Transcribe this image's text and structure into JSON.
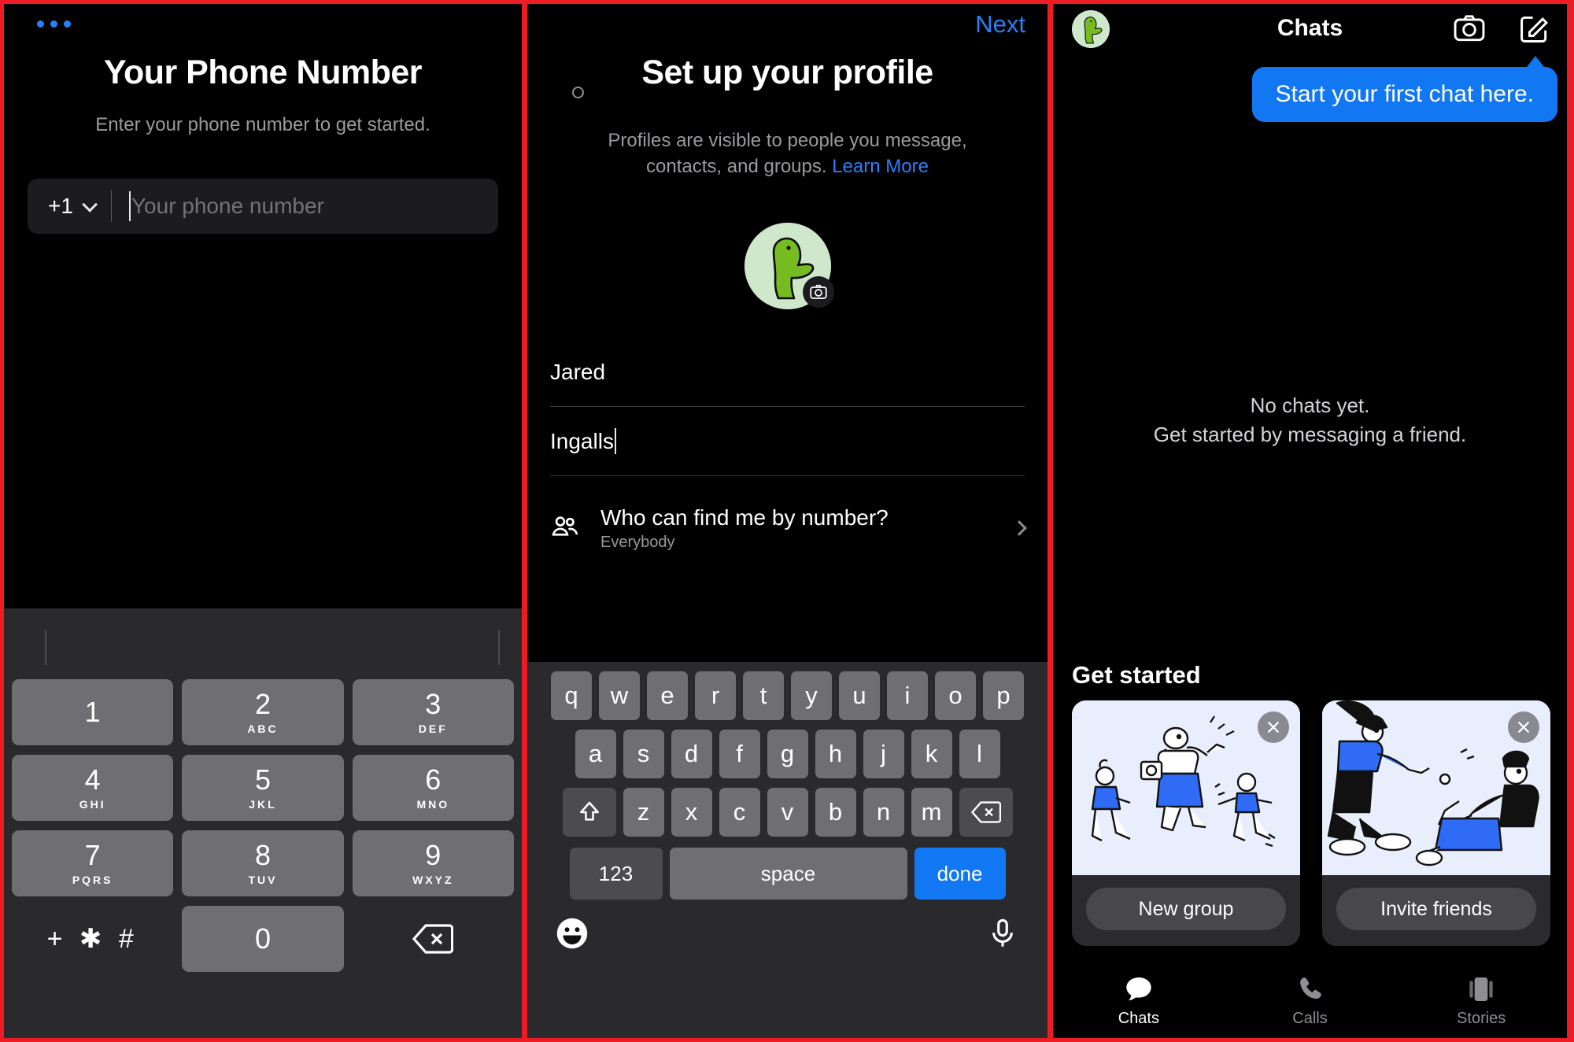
{
  "panel_phone": {
    "menu_icon": "more-dots-icon",
    "title": "Your Phone Number",
    "subtitle": "Enter your phone number to get started.",
    "country_code": "+1",
    "phone_value": "",
    "phone_placeholder": "Your phone number",
    "keypad": [
      {
        "num": "1",
        "sub": ""
      },
      {
        "num": "2",
        "sub": "ABC"
      },
      {
        "num": "3",
        "sub": "DEF"
      },
      {
        "num": "4",
        "sub": "GHI"
      },
      {
        "num": "5",
        "sub": "JKL"
      },
      {
        "num": "6",
        "sub": "MNO"
      },
      {
        "num": "7",
        "sub": "PQRS"
      },
      {
        "num": "8",
        "sub": "TUV"
      },
      {
        "num": "9",
        "sub": "WXYZ"
      },
      {
        "num": "+ ✱ #",
        "sub": ""
      },
      {
        "num": "0",
        "sub": ""
      },
      {
        "num": "delete-icon",
        "sub": ""
      }
    ]
  },
  "panel_profile": {
    "next_label": "Next",
    "back_icon": "back-circle-icon",
    "title": "Set up your profile",
    "subtitle": "Profiles are visible to people you message, contacts, and groups.",
    "learn_more": "Learn More",
    "avatar_icon": "duck-avatar-icon",
    "camera_badge_icon": "camera-icon",
    "first_name": "Jared",
    "last_name": "Ingalls",
    "find_me": {
      "icon": "people-icon",
      "label": "Who can find me by number?",
      "value": "Everybody",
      "chevron": "chevron-right-icon"
    },
    "keyboard": {
      "row1": [
        "q",
        "w",
        "e",
        "r",
        "t",
        "y",
        "u",
        "i",
        "o",
        "p"
      ],
      "row2": [
        "a",
        "s",
        "d",
        "f",
        "g",
        "h",
        "j",
        "k",
        "l"
      ],
      "row3": [
        "z",
        "x",
        "c",
        "v",
        "b",
        "n",
        "m"
      ],
      "shift_icon": "shift-icon",
      "backspace_icon": "backspace-icon",
      "numbers_label": "123",
      "space_label": "space",
      "done_label": "done",
      "emoji_icon": "emoji-icon",
      "mic_icon": "microphone-icon"
    }
  },
  "panel_chats": {
    "avatar_icon": "duck-avatar-icon",
    "title": "Chats",
    "camera_icon": "camera-icon",
    "compose_icon": "compose-icon",
    "tooltip": "Start your first chat here.",
    "empty_line1": "No chats yet.",
    "empty_line2": "Get started by messaging a friend.",
    "get_started_title": "Get started",
    "cards": [
      {
        "button": "New group",
        "close_icon": "close-icon",
        "art": "people-running-illustration"
      },
      {
        "button": "Invite friends",
        "close_icon": "close-icon",
        "art": "people-helping-illustration"
      },
      {
        "button": "",
        "close_icon": "",
        "art": "partial-card-illustration"
      }
    ],
    "tabs": [
      {
        "label": "Chats",
        "icon": "chat-bubble-icon",
        "active": true
      },
      {
        "label": "Calls",
        "icon": "phone-icon",
        "active": false
      },
      {
        "label": "Stories",
        "icon": "stories-icon",
        "active": false
      }
    ]
  },
  "colors": {
    "accent_blue": "#2d7ff9",
    "done_blue": "#1277f2",
    "avatar_bg": "#cfe8cc",
    "avatar_green": "#76bc21",
    "frame_red": "#ed1c24"
  }
}
